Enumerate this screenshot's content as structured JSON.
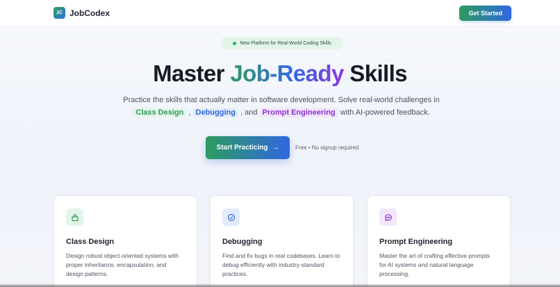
{
  "header": {
    "logo_text": "JC",
    "brand": "JobCodex",
    "cta_label": "Get Started"
  },
  "hero": {
    "badge": "New Platform for Real-World Coding Skills",
    "title_part1": "Master ",
    "title_highlight": "Job-Ready",
    "title_part2": " Skills",
    "subtitle_part1": "Practice the skills that actually matter in software development. Solve real-world challenges in ",
    "chip1": "Class Design",
    "sep1": " , ",
    "chip2": "Debugging",
    "sep2": " , and ",
    "chip3": "Prompt Engineering",
    "subtitle_part2": " with AI-powered feedback.",
    "cta_label": "Start Practicing",
    "cta_arrow": "→",
    "cta_note": "Free • No signup required"
  },
  "cards": [
    {
      "title": "Class Design",
      "description": "Design robust object-oriented systems with proper inheritance, encapsulation, and design patterns.",
      "icon": "lock-icon",
      "color": "#2d9b5f"
    },
    {
      "title": "Debugging",
      "description": "Find and fix bugs in real codebases. Learn to debug efficiently with industry-standard practices.",
      "icon": "check-circle-icon",
      "color": "#2f68e0"
    },
    {
      "title": "Prompt Engineering",
      "description": "Master the art of crafting effective prompts for AI systems and natural language processing.",
      "icon": "chat-bubble-icon",
      "color": "#8a33d4"
    }
  ],
  "colors": {
    "green": "#2d9b5f",
    "blue": "#2f68e0",
    "purple": "#8a33d4"
  }
}
